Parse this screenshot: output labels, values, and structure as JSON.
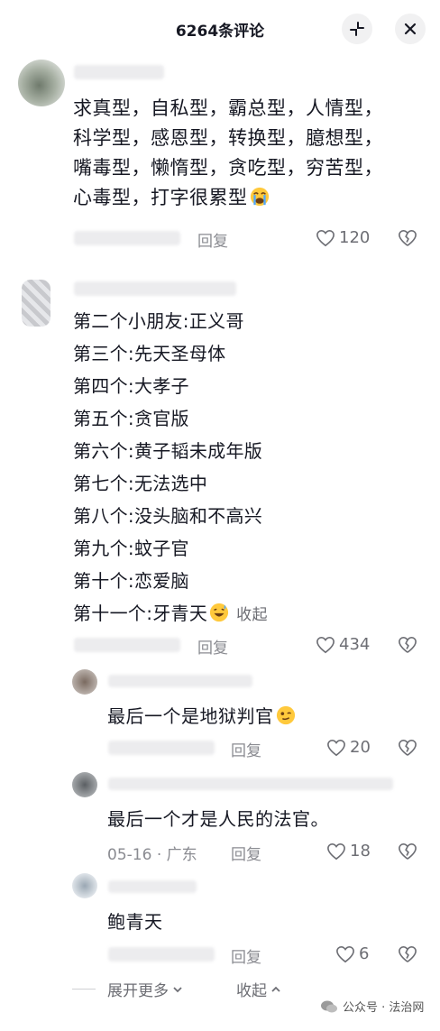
{
  "header": {
    "title": "6264条评论"
  },
  "comment1": {
    "text_lines": [
      "求真型，自私型，霸总型，人情型，",
      "科学型，感恩型，转换型，臆想型，",
      "嘴毒型，懒惰型，贪吃型，穷苦型，",
      "心毒型，打字很累型"
    ],
    "emoji": "loudly-crying-face",
    "reply_label": "回复",
    "likes": "120"
  },
  "comment2": {
    "lines": [
      "第二个小朋友:正义哥",
      "第三个:先天圣母体",
      "第四个:大孝子",
      "第五个:贪官版",
      "第六个:黄子韬未成年版",
      "第七个:无法选中",
      "第八个:没头脑和不高兴",
      "第九个:蚊子官",
      "第十个:恋爱脑",
      "第十一个:牙青天"
    ],
    "emoji": "grinning-sweat-face",
    "collapse_label": "收起",
    "reply_label": "回复",
    "likes": "434"
  },
  "reply1": {
    "text": "最后一个是地狱判官",
    "emoji": "woozy-face",
    "reply_label": "回复",
    "likes": "20"
  },
  "reply2": {
    "text": "最后一个才是人民的法官。",
    "date": "05-16",
    "location": "广东",
    "reply_label": "回复",
    "likes": "18"
  },
  "reply3": {
    "text": "鲍青天",
    "reply_label": "回复",
    "likes": "6"
  },
  "footer": {
    "expand_label": "展开更多",
    "collapse_label": "收起"
  },
  "watermark": {
    "text": "公众号 · 法治网"
  },
  "colors": {
    "text": "#161823",
    "meta": "#8a8b91",
    "button_bg": "#f1f1f2"
  }
}
